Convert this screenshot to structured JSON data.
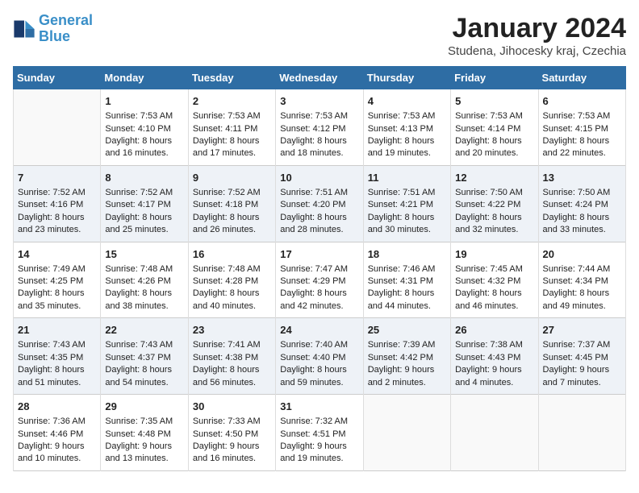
{
  "header": {
    "logo_line1": "General",
    "logo_line2": "Blue",
    "title": "January 2024",
    "subtitle": "Studena, Jihocesky kraj, Czechia"
  },
  "days_of_week": [
    "Sunday",
    "Monday",
    "Tuesday",
    "Wednesday",
    "Thursday",
    "Friday",
    "Saturday"
  ],
  "weeks": [
    [
      {
        "num": "",
        "sunrise": "",
        "sunset": "",
        "daylight": ""
      },
      {
        "num": "1",
        "sunrise": "Sunrise: 7:53 AM",
        "sunset": "Sunset: 4:10 PM",
        "daylight": "Daylight: 8 hours and 16 minutes."
      },
      {
        "num": "2",
        "sunrise": "Sunrise: 7:53 AM",
        "sunset": "Sunset: 4:11 PM",
        "daylight": "Daylight: 8 hours and 17 minutes."
      },
      {
        "num": "3",
        "sunrise": "Sunrise: 7:53 AM",
        "sunset": "Sunset: 4:12 PM",
        "daylight": "Daylight: 8 hours and 18 minutes."
      },
      {
        "num": "4",
        "sunrise": "Sunrise: 7:53 AM",
        "sunset": "Sunset: 4:13 PM",
        "daylight": "Daylight: 8 hours and 19 minutes."
      },
      {
        "num": "5",
        "sunrise": "Sunrise: 7:53 AM",
        "sunset": "Sunset: 4:14 PM",
        "daylight": "Daylight: 8 hours and 20 minutes."
      },
      {
        "num": "6",
        "sunrise": "Sunrise: 7:53 AM",
        "sunset": "Sunset: 4:15 PM",
        "daylight": "Daylight: 8 hours and 22 minutes."
      }
    ],
    [
      {
        "num": "7",
        "sunrise": "Sunrise: 7:52 AM",
        "sunset": "Sunset: 4:16 PM",
        "daylight": "Daylight: 8 hours and 23 minutes."
      },
      {
        "num": "8",
        "sunrise": "Sunrise: 7:52 AM",
        "sunset": "Sunset: 4:17 PM",
        "daylight": "Daylight: 8 hours and 25 minutes."
      },
      {
        "num": "9",
        "sunrise": "Sunrise: 7:52 AM",
        "sunset": "Sunset: 4:18 PM",
        "daylight": "Daylight: 8 hours and 26 minutes."
      },
      {
        "num": "10",
        "sunrise": "Sunrise: 7:51 AM",
        "sunset": "Sunset: 4:20 PM",
        "daylight": "Daylight: 8 hours and 28 minutes."
      },
      {
        "num": "11",
        "sunrise": "Sunrise: 7:51 AM",
        "sunset": "Sunset: 4:21 PM",
        "daylight": "Daylight: 8 hours and 30 minutes."
      },
      {
        "num": "12",
        "sunrise": "Sunrise: 7:50 AM",
        "sunset": "Sunset: 4:22 PM",
        "daylight": "Daylight: 8 hours and 32 minutes."
      },
      {
        "num": "13",
        "sunrise": "Sunrise: 7:50 AM",
        "sunset": "Sunset: 4:24 PM",
        "daylight": "Daylight: 8 hours and 33 minutes."
      }
    ],
    [
      {
        "num": "14",
        "sunrise": "Sunrise: 7:49 AM",
        "sunset": "Sunset: 4:25 PM",
        "daylight": "Daylight: 8 hours and 35 minutes."
      },
      {
        "num": "15",
        "sunrise": "Sunrise: 7:48 AM",
        "sunset": "Sunset: 4:26 PM",
        "daylight": "Daylight: 8 hours and 38 minutes."
      },
      {
        "num": "16",
        "sunrise": "Sunrise: 7:48 AM",
        "sunset": "Sunset: 4:28 PM",
        "daylight": "Daylight: 8 hours and 40 minutes."
      },
      {
        "num": "17",
        "sunrise": "Sunrise: 7:47 AM",
        "sunset": "Sunset: 4:29 PM",
        "daylight": "Daylight: 8 hours and 42 minutes."
      },
      {
        "num": "18",
        "sunrise": "Sunrise: 7:46 AM",
        "sunset": "Sunset: 4:31 PM",
        "daylight": "Daylight: 8 hours and 44 minutes."
      },
      {
        "num": "19",
        "sunrise": "Sunrise: 7:45 AM",
        "sunset": "Sunset: 4:32 PM",
        "daylight": "Daylight: 8 hours and 46 minutes."
      },
      {
        "num": "20",
        "sunrise": "Sunrise: 7:44 AM",
        "sunset": "Sunset: 4:34 PM",
        "daylight": "Daylight: 8 hours and 49 minutes."
      }
    ],
    [
      {
        "num": "21",
        "sunrise": "Sunrise: 7:43 AM",
        "sunset": "Sunset: 4:35 PM",
        "daylight": "Daylight: 8 hours and 51 minutes."
      },
      {
        "num": "22",
        "sunrise": "Sunrise: 7:43 AM",
        "sunset": "Sunset: 4:37 PM",
        "daylight": "Daylight: 8 hours and 54 minutes."
      },
      {
        "num": "23",
        "sunrise": "Sunrise: 7:41 AM",
        "sunset": "Sunset: 4:38 PM",
        "daylight": "Daylight: 8 hours and 56 minutes."
      },
      {
        "num": "24",
        "sunrise": "Sunrise: 7:40 AM",
        "sunset": "Sunset: 4:40 PM",
        "daylight": "Daylight: 8 hours and 59 minutes."
      },
      {
        "num": "25",
        "sunrise": "Sunrise: 7:39 AM",
        "sunset": "Sunset: 4:42 PM",
        "daylight": "Daylight: 9 hours and 2 minutes."
      },
      {
        "num": "26",
        "sunrise": "Sunrise: 7:38 AM",
        "sunset": "Sunset: 4:43 PM",
        "daylight": "Daylight: 9 hours and 4 minutes."
      },
      {
        "num": "27",
        "sunrise": "Sunrise: 7:37 AM",
        "sunset": "Sunset: 4:45 PM",
        "daylight": "Daylight: 9 hours and 7 minutes."
      }
    ],
    [
      {
        "num": "28",
        "sunrise": "Sunrise: 7:36 AM",
        "sunset": "Sunset: 4:46 PM",
        "daylight": "Daylight: 9 hours and 10 minutes."
      },
      {
        "num": "29",
        "sunrise": "Sunrise: 7:35 AM",
        "sunset": "Sunset: 4:48 PM",
        "daylight": "Daylight: 9 hours and 13 minutes."
      },
      {
        "num": "30",
        "sunrise": "Sunrise: 7:33 AM",
        "sunset": "Sunset: 4:50 PM",
        "daylight": "Daylight: 9 hours and 16 minutes."
      },
      {
        "num": "31",
        "sunrise": "Sunrise: 7:32 AM",
        "sunset": "Sunset: 4:51 PM",
        "daylight": "Daylight: 9 hours and 19 minutes."
      },
      {
        "num": "",
        "sunrise": "",
        "sunset": "",
        "daylight": ""
      },
      {
        "num": "",
        "sunrise": "",
        "sunset": "",
        "daylight": ""
      },
      {
        "num": "",
        "sunrise": "",
        "sunset": "",
        "daylight": ""
      }
    ]
  ]
}
